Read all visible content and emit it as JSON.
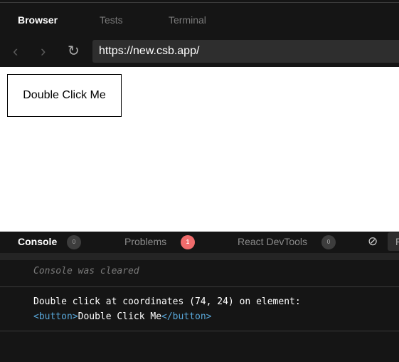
{
  "tabs": [
    {
      "label": "Browser",
      "active": true
    },
    {
      "label": "Tests"
    },
    {
      "label": "Terminal"
    }
  ],
  "nav": {
    "back_icon": "chevron-left-icon",
    "forward_icon": "chevron-right-icon",
    "reload_icon": "reload-icon",
    "url": "https://new.csb.app/"
  },
  "preview": {
    "button_label": "Double Click Me"
  },
  "console_tabs": [
    {
      "label": "Console",
      "count": "0",
      "active": true
    },
    {
      "label": "Problems",
      "count": "1"
    },
    {
      "label": "React DevTools",
      "count": "0"
    }
  ],
  "console_tools": {
    "clear_icon": "block-icon",
    "cut_label": "F"
  },
  "console": {
    "cleared": "Console was cleared",
    "log_text": "Double click at coordinates (74, 24) on element:",
    "open_tag": "<button>",
    "element_text": "Double Click Me",
    "close_tag": "</button>"
  },
  "colors": {
    "accent_red": "#f06c6c",
    "tag_blue": "#58a6d8"
  }
}
